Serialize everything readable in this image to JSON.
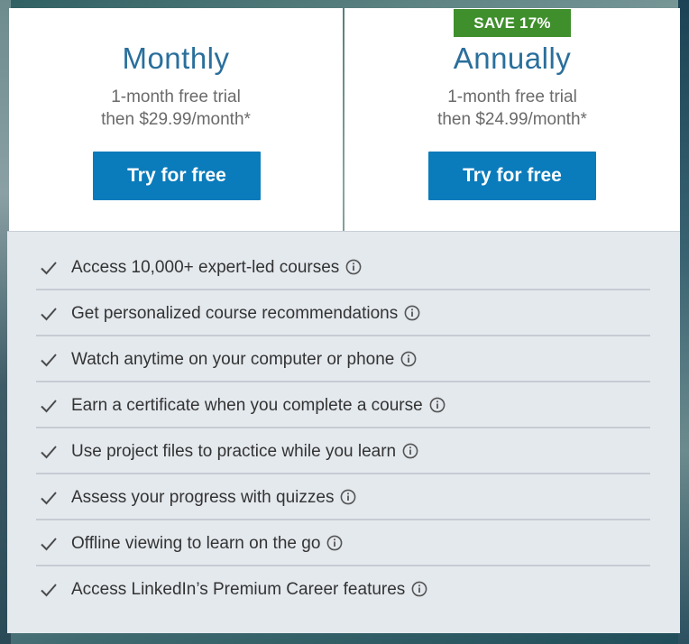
{
  "plans": {
    "monthly": {
      "title": "Monthly",
      "desc_line1": "1-month free trial",
      "desc_line2": "then $29.99/month*",
      "button_label": "Try for free"
    },
    "annual": {
      "badge": "SAVE 17%",
      "title": "Annually",
      "desc_line1": "1-month free trial",
      "desc_line2": "then $24.99/month*",
      "button_label": "Try for free"
    }
  },
  "features": [
    {
      "label": "Access 10,000+ expert-led courses",
      "icon": "info-icon"
    },
    {
      "label": "Get personalized course recommendations",
      "icon": "info-icon"
    },
    {
      "label": "Watch anytime on your computer or phone",
      "icon": "info-icon"
    },
    {
      "label": "Earn a certificate when you complete a course",
      "icon": "info-icon"
    },
    {
      "label": "Use project files to practice while you learn",
      "icon": "info-icon"
    },
    {
      "label": "Assess your progress with quizzes",
      "icon": "info-icon"
    },
    {
      "label": "Offline viewing to learn on the go",
      "icon": "info-icon"
    },
    {
      "label": "Access LinkedIn’s Premium Career features",
      "icon": "info-icon"
    }
  ],
  "colors": {
    "accent": "#0a7bbb",
    "title": "#2a6f9c",
    "badge": "#3f8f2c",
    "features_bg": "#e4e9ee"
  }
}
